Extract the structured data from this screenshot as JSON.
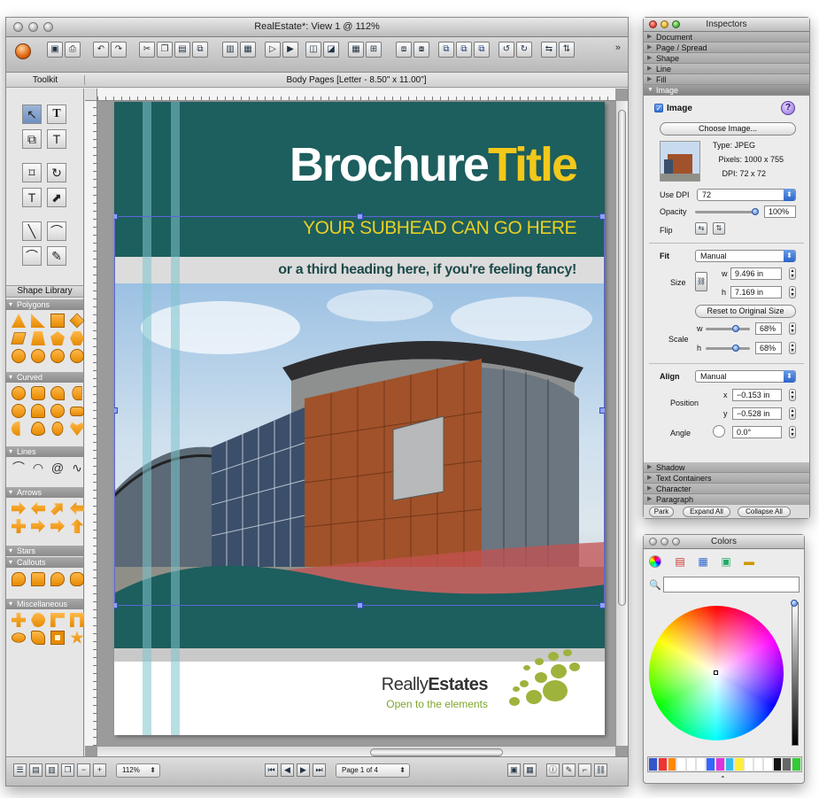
{
  "main_window": {
    "title": "RealEstate*: View 1 @ 112%",
    "toolkit_label": "Toolkit",
    "page_info": "Body Pages  [Letter - 8.50\" x 11.00\"]",
    "shape_library_label": "Shape Library",
    "shape_sections": [
      "Polygons",
      "Curved",
      "Lines",
      "Arrows",
      "Stars",
      "Callouts",
      "Miscellaneous"
    ],
    "zoom_value": "112%",
    "page_indicator": "Page 1 of 4"
  },
  "document": {
    "title_part1": "Brochure",
    "title_part2": "Title",
    "subhead": "YOUR SUBHEAD CAN GO HERE",
    "third_heading": "or a third heading here, if you're feeling fancy!",
    "logo_name_regular": "Really",
    "logo_name_bold": "Estates",
    "logo_tagline": "Open to the elements",
    "colors": {
      "teal": "#1d5e5e",
      "yellow": "#f2c81b",
      "green": "#7fa62b"
    }
  },
  "inspectors": {
    "title": "Inspectors",
    "sections_top": [
      "Document",
      "Page / Spread",
      "Shape",
      "Line",
      "Fill"
    ],
    "open_section": "Image",
    "sections_bottom": [
      "Shadow",
      "Text Containers",
      "Character",
      "Paragraph"
    ],
    "image": {
      "checkbox_label": "Image",
      "choose_button": "Choose Image...",
      "type": "Type:  JPEG",
      "pixels": "Pixels:  1000 x 755",
      "dpi": "DPI:  72 x 72",
      "use_dpi_label": "Use DPI",
      "use_dpi_value": "72",
      "opacity_label": "Opacity",
      "opacity_value": "100%",
      "opacity_level": 1.0,
      "flip_label": "Flip",
      "fit_label": "Fit",
      "fit_value": "Manual",
      "size_label": "Size",
      "w_label": "w",
      "w_value": "9.496 in",
      "h_label": "h",
      "h_value": "7.169 in",
      "reset_button": "Reset to Original Size",
      "scale_label": "Scale",
      "scale_w_label": "w",
      "scale_w_value": "68%",
      "scale_h_label": "h",
      "scale_h_value": "68%",
      "align_label": "Align",
      "align_value": "Manual",
      "position_label": "Position",
      "x_label": "x",
      "x_value": "−0.153 in",
      "y_label": "y",
      "y_value": "−0.528 in",
      "angle_label": "Angle",
      "angle_value": "0.0°"
    },
    "footer": {
      "park": "Park",
      "expand": "Expand All",
      "collapse": "Collapse All"
    }
  },
  "colors_panel": {
    "title": "Colors",
    "swatches": [
      "#3355cc",
      "#ee3333",
      "#ff8800",
      "#ffffff",
      "#ffffff",
      "#ffffff",
      "#3366ff",
      "#dd33dd",
      "#33bbee",
      "#ffee33",
      "#ffffff",
      "#ffffff",
      "#ffffff",
      "#111111",
      "#666666",
      "#33cc33"
    ]
  }
}
